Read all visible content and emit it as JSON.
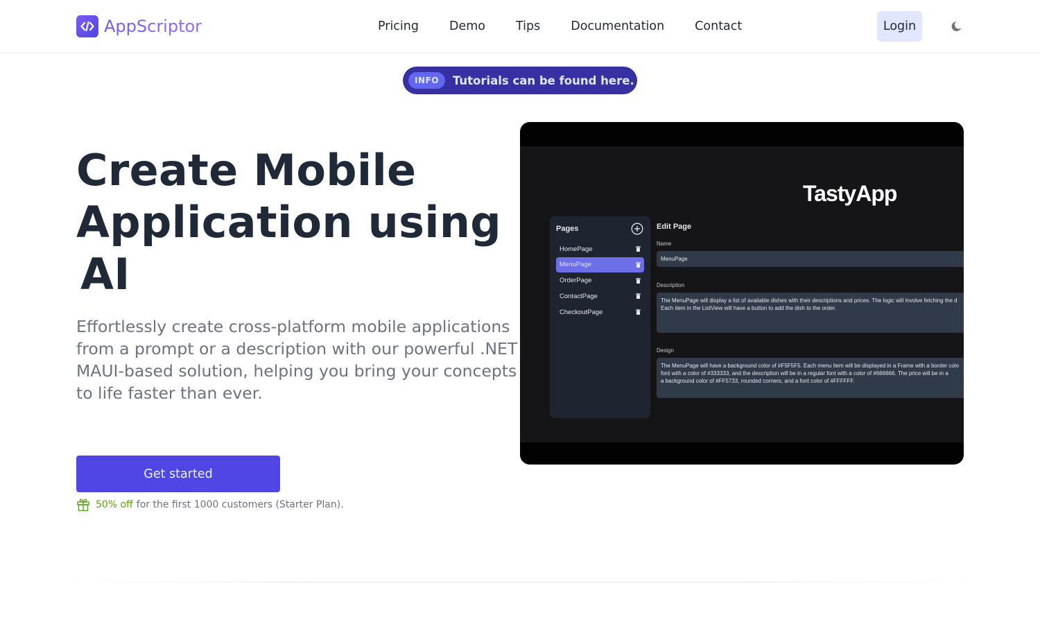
{
  "header": {
    "brand": "AppScriptor",
    "nav": [
      {
        "label": "Pricing"
      },
      {
        "label": "Demo"
      },
      {
        "label": "Tips"
      },
      {
        "label": "Documentation"
      },
      {
        "label": "Contact"
      }
    ],
    "login_label": "Login",
    "theme_icon": "moon-icon"
  },
  "announcement": {
    "badge": "INFO",
    "text": "Tutorials can be found here."
  },
  "hero": {
    "title_line1": "Create Mobile",
    "title_line2": "Application using",
    "title_highlight": "AI",
    "description": "Effortlessly create cross-platform mobile applications from a prompt or a description with our powerful .NET MAUI-based solution, helping you bring your concepts to life faster than ever.",
    "cta_label": "Get started",
    "promo_highlight": "50% off",
    "promo_text": "for the first 1000 customers (Starter Plan)."
  },
  "preview": {
    "app_title": "TastyApp",
    "pages_header": "Pages",
    "pages": [
      {
        "name": "HomePage",
        "active": false
      },
      {
        "name": "MenuPage",
        "active": true
      },
      {
        "name": "OrderPage",
        "active": false
      },
      {
        "name": "ContactPage",
        "active": false
      },
      {
        "name": "CheckoutPage",
        "active": false
      }
    ],
    "edit_title": "Edit Page",
    "name_label": "Name",
    "name_value": "MenuPage",
    "description_label": "Description",
    "description_lines": [
      "The MenuPage will display a list of available dishes with their descriptions and prices. The logic will involve fetching the d",
      "Each item in the ListView will have a button to add the dish to the order."
    ],
    "design_label": "Design",
    "design_lines": [
      "The MenuPage will have a background color of #F5F5F5. Each menu item will be displayed in a Frame with a border colo",
      "font with a color of #333333, and the description will be in a regular font with a color of #666666. The price will be in a",
      "a background color of #FF5733, rounded corners, and a font color of #FFFFFF."
    ]
  },
  "colors": {
    "primary": "#4f46e5",
    "highlight": "#c7d2fe",
    "announcement_bg": "#3730a3",
    "promo_green": "#57a01a",
    "login_bg": "#e0e7ff"
  }
}
